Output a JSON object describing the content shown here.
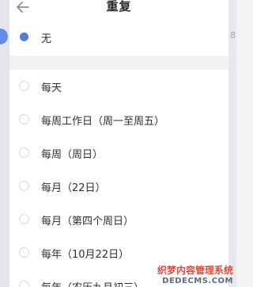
{
  "header": {
    "title": "重复",
    "back_icon": "arrow-left-icon"
  },
  "background": {
    "right_char": "8"
  },
  "top_option": {
    "label": "无",
    "selected": true
  },
  "options": [
    {
      "label": "每天",
      "selected": false
    },
    {
      "label": "每周工作日（周一至周五）",
      "selected": false
    },
    {
      "label": "每周（周日）",
      "selected": false
    },
    {
      "label": "每月（22日）",
      "selected": false
    },
    {
      "label": "每月（第四个周日）",
      "selected": false
    },
    {
      "label": "每年（10月22日）",
      "selected": false
    },
    {
      "label": "每年（农历九月初三）",
      "selected": false
    }
  ],
  "watermark": {
    "line1": "织梦内容管理系统",
    "line2": "DEDECMS.COM"
  },
  "colors": {
    "accent": "#4a7be8",
    "watermark_red": "#e24a3b"
  }
}
